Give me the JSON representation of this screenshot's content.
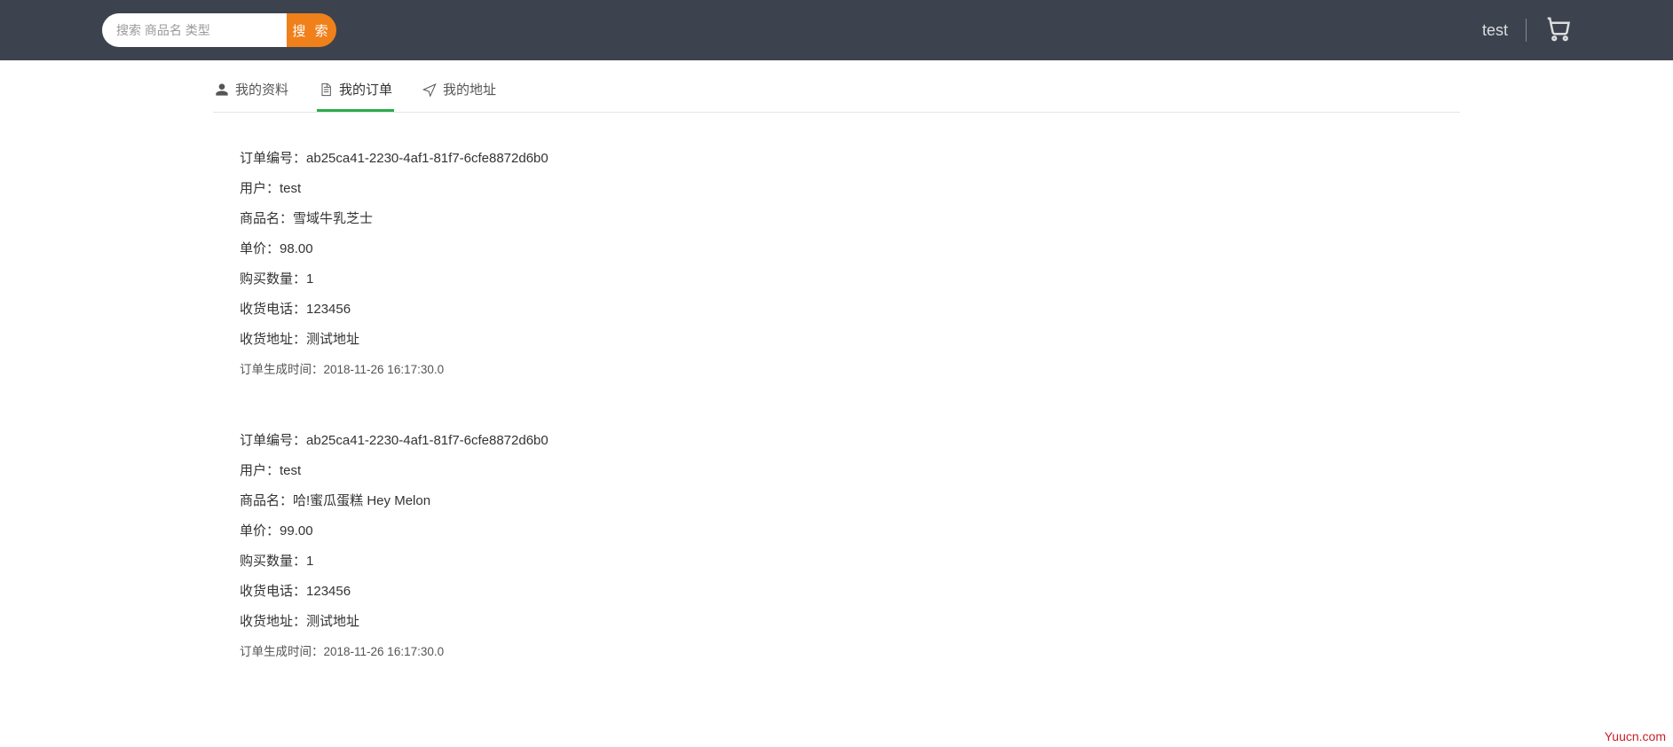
{
  "header": {
    "search_placeholder": "搜索 商品名 类型",
    "search_button": "搜 索",
    "username": "test"
  },
  "tabs": [
    {
      "label": "我的资料"
    },
    {
      "label": "我的订单"
    },
    {
      "label": "我的地址"
    }
  ],
  "labels": {
    "order_no": "订单编号：",
    "user": "用户：",
    "product": "商品名：",
    "price": "单价：",
    "quantity": "购买数量：",
    "phone": "收货电话：",
    "address": "收货地址：",
    "created": "订单生成时间："
  },
  "orders": [
    {
      "order_no": "ab25ca41-2230-4af1-81f7-6cfe8872d6b0",
      "user": "test",
      "product": "雪域牛乳芝士",
      "price": "98.00",
      "quantity": "1",
      "phone": "123456",
      "address": "测试地址",
      "created": "2018-11-26 16:17:30.0"
    },
    {
      "order_no": "ab25ca41-2230-4af1-81f7-6cfe8872d6b0",
      "user": "test",
      "product": "哈!蜜瓜蛋糕 Hey Melon",
      "price": "99.00",
      "quantity": "1",
      "phone": "123456",
      "address": "测试地址",
      "created": "2018-11-26 16:17:30.0"
    }
  ],
  "watermark": "Yuucn.com"
}
